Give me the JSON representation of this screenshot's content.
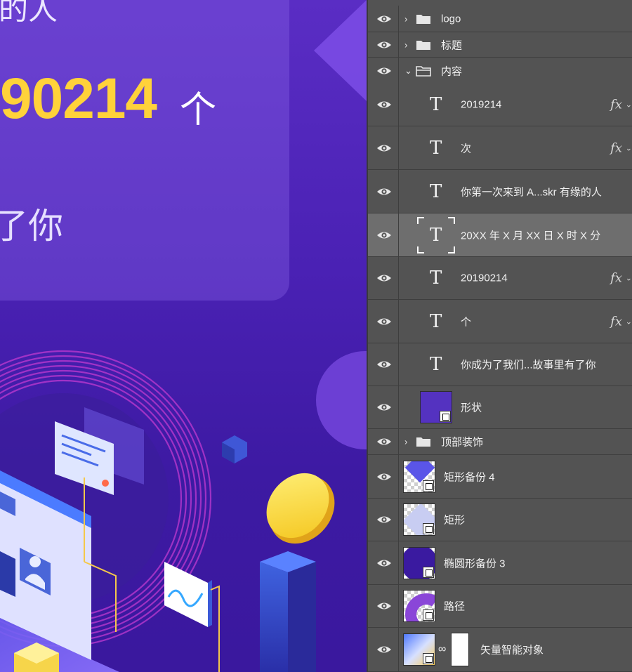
{
  "canvas": {
    "line_top": "的人",
    "big_number": "90214",
    "unit": "个",
    "line_you": "了你",
    "colors": {
      "number": "#ffd23a",
      "background": "#4a21b4"
    }
  },
  "layers": [
    {
      "kind": "group",
      "name": "logo",
      "expanded": false
    },
    {
      "kind": "group",
      "name": "标题",
      "expanded": false
    },
    {
      "kind": "group",
      "name": "内容",
      "expanded": true
    },
    {
      "kind": "text",
      "name": "2019214",
      "fx": "fx"
    },
    {
      "kind": "text",
      "name": "次",
      "fx": "fx"
    },
    {
      "kind": "text",
      "name": "你第一次来到 A...skr 有缘的人"
    },
    {
      "kind": "text",
      "name": "20XX 年 X 月 XX 日 X 时 X 分",
      "selected": true
    },
    {
      "kind": "text",
      "name": "20190214",
      "fx": "fx"
    },
    {
      "kind": "text",
      "name": "个",
      "fx": "fx"
    },
    {
      "kind": "text",
      "name": "你成为了我们...故事里有了你"
    },
    {
      "kind": "shape",
      "name": "形状"
    },
    {
      "kind": "group",
      "name": "顶部装饰",
      "expanded": false
    },
    {
      "kind": "shape",
      "name": "矩形备份 4"
    },
    {
      "kind": "shape",
      "name": "矩形"
    },
    {
      "kind": "shape",
      "name": "椭圆形备份 3"
    },
    {
      "kind": "shape",
      "name": "路径"
    },
    {
      "kind": "smart",
      "name": "矢量智能对象"
    }
  ]
}
